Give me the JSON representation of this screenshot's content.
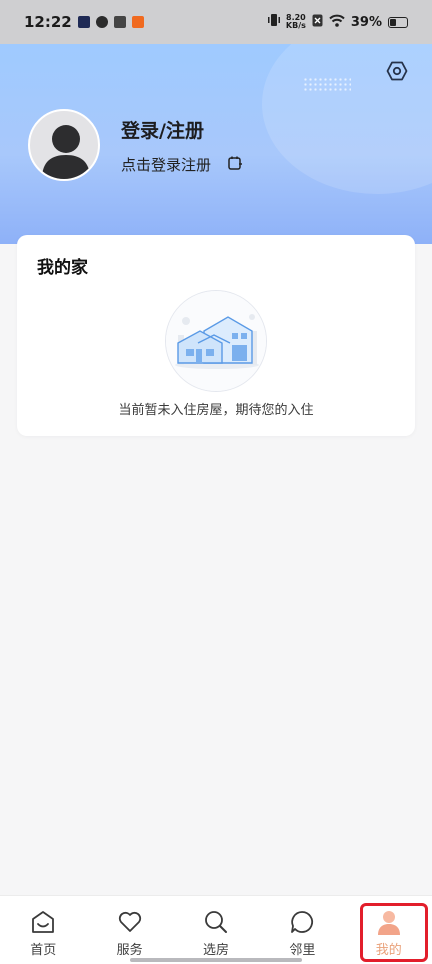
{
  "status_bar": {
    "time": "12:22",
    "net_speed_value": "8.20",
    "net_speed_unit": "KB/s",
    "battery": "39%",
    "battery_level": 0.39
  },
  "profile": {
    "title": "登录/注册",
    "subtitle": "点击登录注册"
  },
  "home_card": {
    "title": "我的家",
    "empty_text": "当前暂未入住房屋，期待您的入住"
  },
  "nav": {
    "items": [
      {
        "label": "首页",
        "icon": "home-icon"
      },
      {
        "label": "服务",
        "icon": "heart-icon"
      },
      {
        "label": "选房",
        "icon": "search-icon"
      },
      {
        "label": "邻里",
        "icon": "chat-bubble-icon"
      },
      {
        "label": "我的",
        "icon": "user-icon"
      }
    ],
    "active_index": 4
  },
  "colors": {
    "header_blue": "#9fcaff",
    "active_nav": "#e9a17a",
    "highlight_red": "#e21e2b"
  }
}
